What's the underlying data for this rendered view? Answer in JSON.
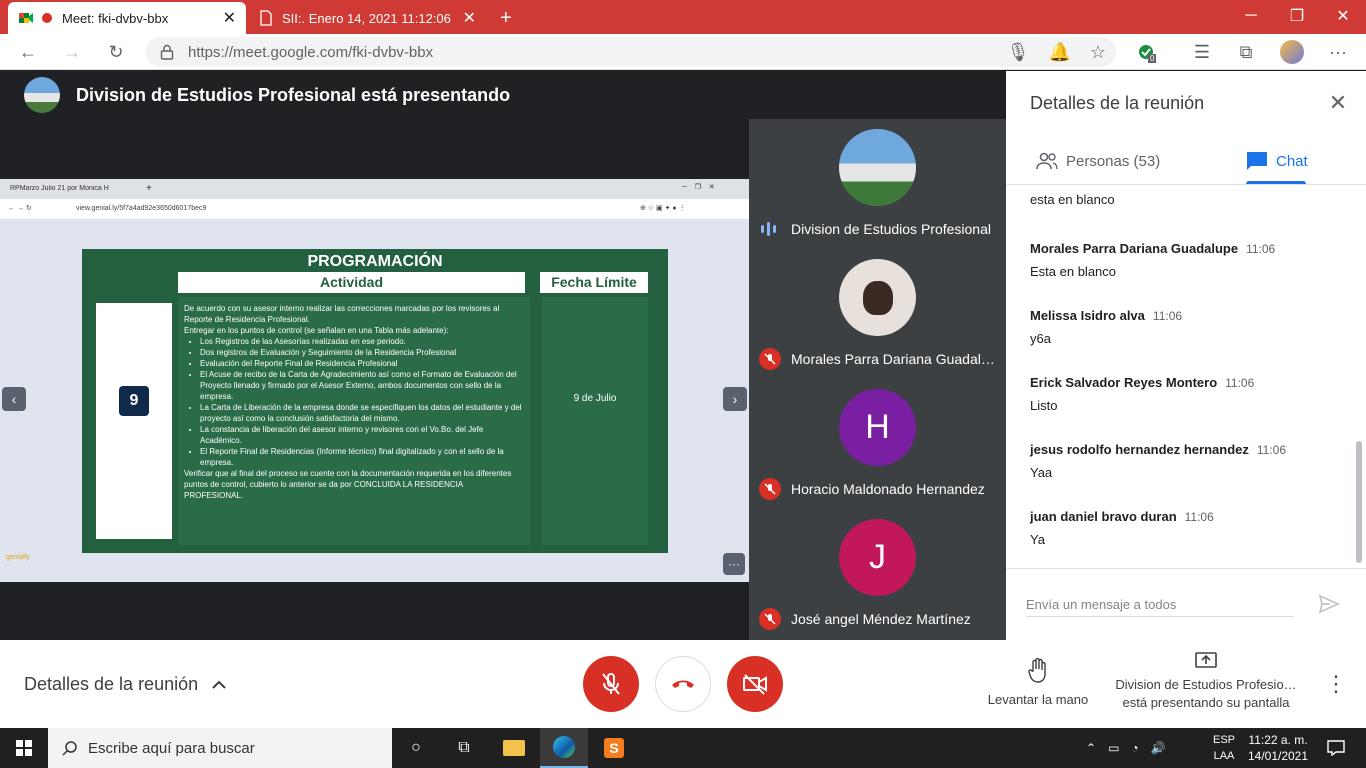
{
  "browser": {
    "tabs": [
      {
        "title": "Meet: fki-dvbv-bbx",
        "active": true
      },
      {
        "title": "SII:. Enero 14, 2021 11:12:06",
        "active": false
      }
    ],
    "new_tab": "+",
    "url": "https://meet.google.com/fki-dvbv-bbx",
    "extension_badge": "0"
  },
  "meet": {
    "presenter_banner": "Division de Estudios Profesional está presentando",
    "participants": [
      {
        "name": "Division de Estudios Profesional",
        "muted": false,
        "speaking": true,
        "avatar_letter": "",
        "avatar_color": "#4a90c8"
      },
      {
        "name": "Morales Parra Dariana Guadalupe",
        "display": "Morales Parra Dariana Guadalu…",
        "muted": true,
        "avatar_letter": "",
        "avatar_color": "#e8e0da"
      },
      {
        "name": "Horacio Maldonado Hernandez",
        "muted": true,
        "avatar_letter": "H",
        "avatar_color": "#7b1fa2"
      },
      {
        "name": "José angel Méndez Martínez",
        "muted": true,
        "avatar_letter": "J",
        "avatar_color": "#c2185b"
      }
    ],
    "shared_screen": {
      "inner_tab": "RPMarzo Julio 21 por Monica H",
      "inner_url": "view.genial.ly/5f7a4ad92e3650d6017bec9",
      "slide": {
        "title": "PROGRAMACIÓN",
        "col1_header": "Actividad",
        "col2_header": "Fecha Límite",
        "number": "9",
        "intro": "De acuerdo con su asesor interno realizar las correcciones marcadas por los revisores al Reporte de Residencia Profesional.",
        "intro2": "Entregar en los puntos de control (se señalan en una Tabla más adelante):",
        "bullets": [
          "Los Registros de las Asesorías realizadas en ese periodo.",
          "Dos registros de Evaluación y Seguimiento de la Residencia Profesional",
          "Evaluación del Reporte Final de Residencia Profesional",
          "El Acuse de recibo de la Carta de Agradecimiento así como el Formato de Evaluación del Proyecto llenado y firmado por el Asesor Externo, ambos documentos con sello de la empresa.",
          "La Carta de Liberación de la empresa donde se especifiquen los datos del estudiante y del proyecto así como la conclusión satisfactoria del mismo.",
          "La constancia de liberación del asesor interno y revisores con el Vo.Bo. del Jefe Académico.",
          "El Reporte Final de Residencias (Informe técnico) final digitalizado y con el sello de la empresa."
        ],
        "closing": "Verificar que al final del proceso se cuente con la documentación requerida en los diferentes puntos de control, cubierto lo anterior se da por CONCLUIDA LA RESIDENCIA PROFESIONAL.",
        "due_date": "9 de Julio"
      },
      "logo_text": "genially"
    }
  },
  "panel": {
    "title": "Detalles de la reunión",
    "tab_people": "Personas (53)",
    "tab_chat": "Chat",
    "messages": [
      {
        "sender": "",
        "time": "",
        "text": "esta en blanco"
      },
      {
        "sender": "Morales Parra Dariana Guadalupe",
        "time": "11:06",
        "text": "Esta en blanco"
      },
      {
        "sender": "Melissa Isidro alva",
        "time": "11:06",
        "text": "y6a"
      },
      {
        "sender": "Erick Salvador Reyes Montero",
        "time": "11:06",
        "text": "Listo"
      },
      {
        "sender": "jesus rodolfo hernandez hernandez",
        "time": "11:06",
        "text": "Yaa"
      },
      {
        "sender": "juan daniel bravo duran",
        "time": "11:06",
        "text": "Ya"
      }
    ],
    "composer_placeholder": "Envía un mensaje a todos"
  },
  "controls": {
    "meeting_details": "Detalles de la reunión",
    "raise_hand": "Levantar la mano",
    "presenting_line1": "Division de Estudios Profesio…",
    "presenting_line2": "está presentando su pantalla"
  },
  "taskbar": {
    "search_placeholder": "Escribe aquí para buscar",
    "lang_line1": "ESP",
    "lang_line2": "LAA",
    "time": "11:22 a. m.",
    "date": "14/01/2021"
  },
  "colors": {
    "chrome_red": "#cf3a35",
    "meet_red": "#d93025",
    "chat_blue": "#1a73e8",
    "slide_green": "#23603f"
  }
}
